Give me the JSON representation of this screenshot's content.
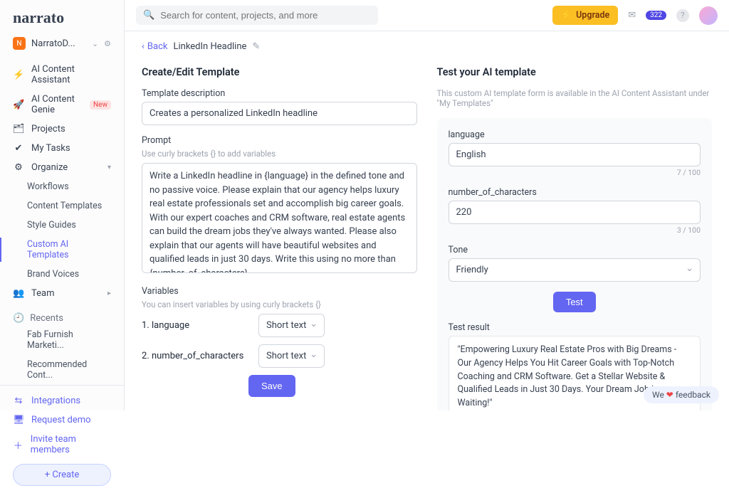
{
  "brand": "narrato",
  "workspace": {
    "badge": "N",
    "name": "NarratoD..."
  },
  "topbar": {
    "search_placeholder": "Search for content, projects, and more",
    "upgrade": "Upgrade",
    "notification_count": "322"
  },
  "sidebar": {
    "ai_assistant": "AI Content Assistant",
    "ai_genie": "AI Content Genie",
    "new_badge": "New",
    "projects": "Projects",
    "my_tasks": "My Tasks",
    "organize": "Organize",
    "workflows": "Workflows",
    "content_templates": "Content Templates",
    "style_guides": "Style Guides",
    "custom_ai": "Custom AI Templates",
    "brand_voices": "Brand Voices",
    "team": "Team",
    "recents": "Recents",
    "recent_1": "Fab Furnish Marketi...",
    "recent_2": "Recommended Cont...",
    "integrations": "Integrations",
    "request_demo": "Request demo",
    "invite": "Invite team members",
    "create": "+ Create"
  },
  "crumbs": {
    "back": "Back",
    "title": "LinkedIn Headline"
  },
  "left": {
    "heading": "Create/Edit Template",
    "desc_label": "Template description",
    "desc_value": "Creates a personalized LinkedIn headline",
    "prompt_label": "Prompt",
    "prompt_hint": "Use curly brackets {} to add variables",
    "prompt_value": "Write a LinkedIn headline in {language} in the defined tone and no passive voice. Please explain that our agency helps luxury real estate professionals set and accomplish big career goals. With our expert coaches and CRM software, real estate agents can build the dream jobs they've always wanted. Please also explain that our agents will have beautiful websites and qualified leads in just 30 days. Write this using no more than {number_of_characters}",
    "vars_label": "Variables",
    "vars_hint": "You can insert variables by using curly brackets {}",
    "var1_label": "1. language",
    "var2_label": "2. number_of_characters",
    "var_type": "Short text",
    "save": "Save"
  },
  "right": {
    "heading": "Test your AI template",
    "subtitle": "This custom AI template form is available in the AI Content Assistant under \"My Templates\"",
    "lang_label": "language",
    "lang_value": "English",
    "lang_count": "7 / 100",
    "num_label": "number_of_characters",
    "num_value": "220",
    "num_count": "3 / 100",
    "tone_label": "Tone",
    "tone_value": "Friendly",
    "test": "Test",
    "result_label": "Test result",
    "result_value": "\"Empowering Luxury Real Estate Pros with Big Dreams - Our Agency Helps You Hit Career Goals with Top-Notch Coaching and CRM Software. Get a Stellar Website & Qualified Leads in Just 30 Days. Your Dream Job is Waiting!\""
  },
  "feedback": {
    "pre": "We ",
    "heart": "❤",
    "post": " feedback"
  }
}
